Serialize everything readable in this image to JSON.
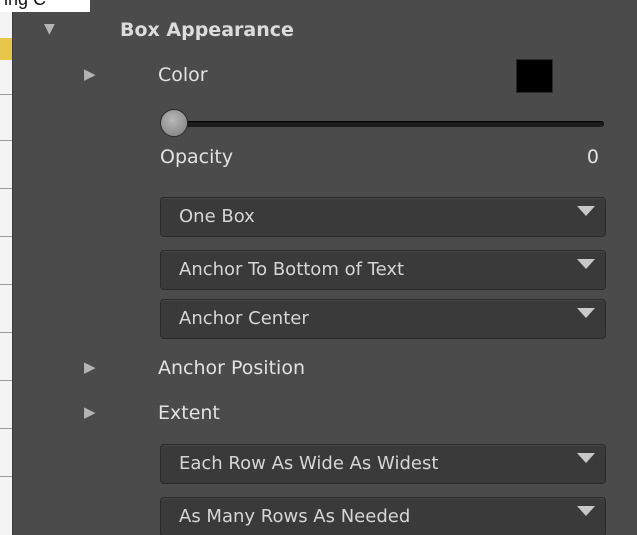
{
  "top_clip_text": "ing C",
  "section": {
    "title": "Box Appearance",
    "expanded": true
  },
  "color_row": {
    "label": "Color",
    "swatch_color": "#000000"
  },
  "opacity": {
    "label": "Opacity",
    "value": "0"
  },
  "dropdowns": [
    {
      "selected": "One Box"
    },
    {
      "selected": "Anchor To Bottom of Text"
    },
    {
      "selected": "Anchor Center"
    },
    {
      "selected": "Each Row As Wide As Widest"
    },
    {
      "selected": "As Many Rows As Needed"
    }
  ],
  "anchor_position": {
    "label": "Anchor Position"
  },
  "extent": {
    "label": "Extent"
  },
  "icons": {
    "expand": "disclosure-triangle-right",
    "collapse": "disclosure-triangle-down",
    "dropdown": "dropdown-arrow"
  },
  "colors": {
    "panel_bg": "#4b4b4b",
    "dropdown_bg": "#3a3a3a",
    "text": "#e2e2e2"
  }
}
